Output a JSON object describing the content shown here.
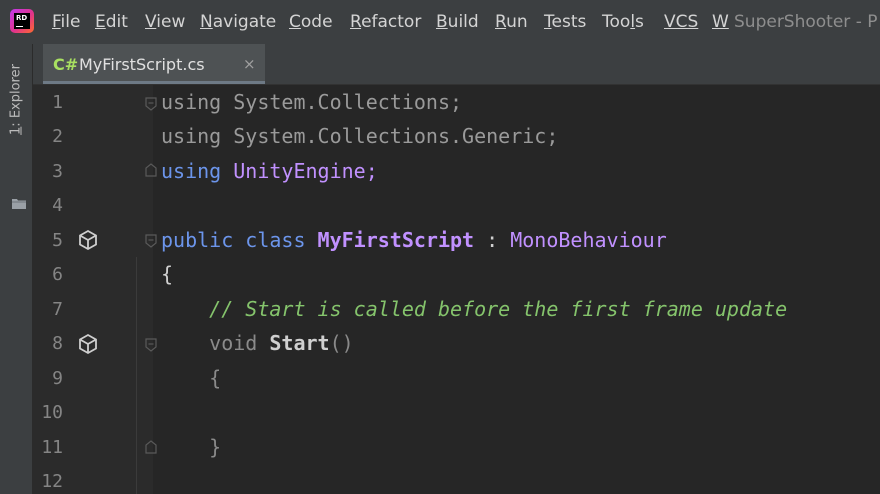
{
  "app": {
    "logo_text": "RD",
    "window_title": "SuperShooter - P"
  },
  "menu": [
    {
      "label": "File",
      "mnemonic": "F",
      "rest": "ile"
    },
    {
      "label": "Edit",
      "mnemonic": "E",
      "rest": "dit"
    },
    {
      "label": "View",
      "mnemonic": "V",
      "rest": "iew"
    },
    {
      "label": "Navigate",
      "mnemonic": "N",
      "rest": "avigate"
    },
    {
      "label": "Code",
      "mnemonic": "C",
      "rest": "ode"
    },
    {
      "label": "Refactor",
      "mnemonic": "R",
      "rest": "efactor"
    },
    {
      "label": "Build",
      "mnemonic": "B",
      "rest": "uild"
    },
    {
      "label": "Run",
      "mnemonic": "R",
      "rest": "un"
    },
    {
      "label": "Tests",
      "mnemonic": "T",
      "rest": "ests"
    },
    {
      "label": "Tools",
      "pre": "Too",
      "mnemonic": "l",
      "rest": "s"
    },
    {
      "label": "VCS",
      "mnemonic": "",
      "rest": "VCS"
    },
    {
      "label": "W",
      "mnemonic": "W",
      "rest": ""
    }
  ],
  "sidebar": {
    "explorer_num": "1",
    "explorer_label": ": Explorer"
  },
  "tab": {
    "lang": "C#",
    "filename": "MyFirstScript.cs",
    "close": "×"
  },
  "editor": {
    "line_numbers": [
      "1",
      "2",
      "3",
      "4",
      "5",
      "6",
      "7",
      "8",
      "9",
      "10",
      "11",
      "12"
    ],
    "lines": {
      "l1_kw": "using",
      "l1_ns": " System.Collections;",
      "l2_kw": "using",
      "l2_ns": " System.Collections.Generic;",
      "l3_kw": "using",
      "l3_ns": " UnityEngine;",
      "l5_public": "public",
      "l5_class": " class ",
      "l5_name": "MyFirstScript",
      "l5_colon": " : ",
      "l5_base": "MonoBehaviour",
      "l6": "{",
      "l7_indent": "    ",
      "l7_comment": "// Start is called before the first frame update",
      "l8_indent": "    ",
      "l8_void": "void ",
      "l8_method": "Start",
      "l8_parens": "()",
      "l9_indent": "    ",
      "l9": "{",
      "l11_indent": "    ",
      "l11": "}"
    }
  },
  "colors": {
    "keyword": "#6c95eb",
    "class_name": "#c191ff",
    "comment": "#85c46c",
    "background": "#262626",
    "chrome": "#3c3f41"
  }
}
